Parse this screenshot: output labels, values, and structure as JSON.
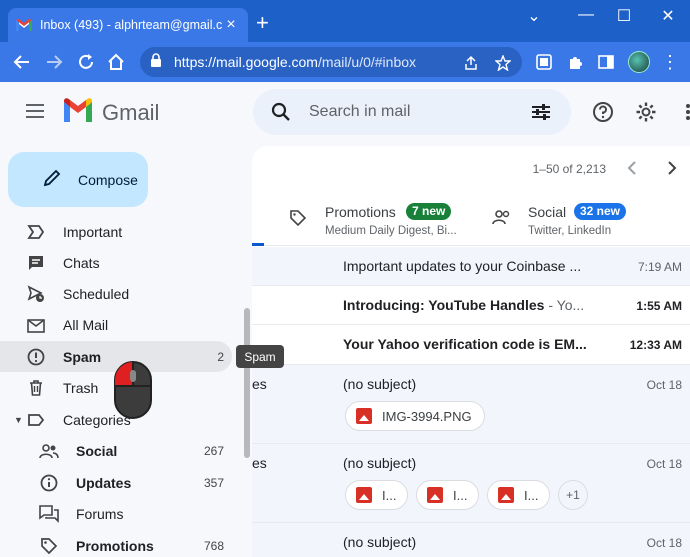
{
  "browser": {
    "tab_title": "Inbox (493) - alphrteam@gmail.c",
    "url_host": "https://mail.google.com",
    "url_path": "/mail/u/0/#inbox",
    "window_controls": {
      "chevron": "⌄",
      "minimize": "—",
      "maximize": "☐",
      "close": "✕"
    }
  },
  "gmail": {
    "product_name": "Gmail",
    "search_placeholder": "Search in mail",
    "compose_label": "Compose"
  },
  "sidebar": {
    "items": [
      {
        "label": "Important",
        "icon": "important-icon"
      },
      {
        "label": "Chats",
        "icon": "chat-icon"
      },
      {
        "label": "Scheduled",
        "icon": "scheduled-icon"
      },
      {
        "label": "All Mail",
        "icon": "all-mail-icon"
      },
      {
        "label": "Spam",
        "count": "2",
        "icon": "spam-icon",
        "active": true
      },
      {
        "label": "Trash",
        "icon": "trash-icon"
      },
      {
        "label": "Categories",
        "icon": "label-icon"
      }
    ],
    "categories": [
      {
        "label": "Social",
        "count": "267",
        "icon": "people-icon"
      },
      {
        "label": "Updates",
        "count": "357",
        "icon": "info-icon"
      },
      {
        "label": "Forums",
        "icon": "forum-icon"
      },
      {
        "label": "Promotions",
        "count": "768",
        "icon": "tag-icon"
      }
    ],
    "tooltip": "Spam"
  },
  "main": {
    "pager": "1–50 of 2,213",
    "tabs": [
      {
        "name": "Promotions",
        "badge": "7 new",
        "badge_color": "#188038",
        "sub": "Medium Daily Digest, Bi..."
      },
      {
        "name": "Social",
        "badge": "32 new",
        "badge_color": "#1a73e8",
        "sub": "Twitter, LinkedIn"
      }
    ],
    "mails": [
      {
        "sender": "",
        "subject": "Important updates to your Coinbase ...",
        "snippet": "",
        "date": "7:19 AM",
        "unread": false
      },
      {
        "sender": "",
        "subject": "Introducing: YouTube Handles",
        "snippet": " - Yo...",
        "date": "1:55 AM",
        "unread": true
      },
      {
        "sender": "",
        "subject": "Your Yahoo verification code is EM...",
        "snippet": "",
        "date": "12:33 AM",
        "unread": true
      },
      {
        "sender": "es",
        "subject": "(no subject)",
        "snippet": "",
        "date": "Oct 18",
        "unread": false,
        "attachments": [
          "IMG-3994.PNG"
        ]
      },
      {
        "sender": "es",
        "subject": "(no subject)",
        "snippet": "",
        "date": "Oct 18",
        "unread": false,
        "attachments": [
          "I...",
          "I...",
          "I..."
        ],
        "more": "+1"
      },
      {
        "sender": "",
        "subject": "(no subject)",
        "snippet": "",
        "date": "Oct 18",
        "unread": false
      }
    ]
  }
}
